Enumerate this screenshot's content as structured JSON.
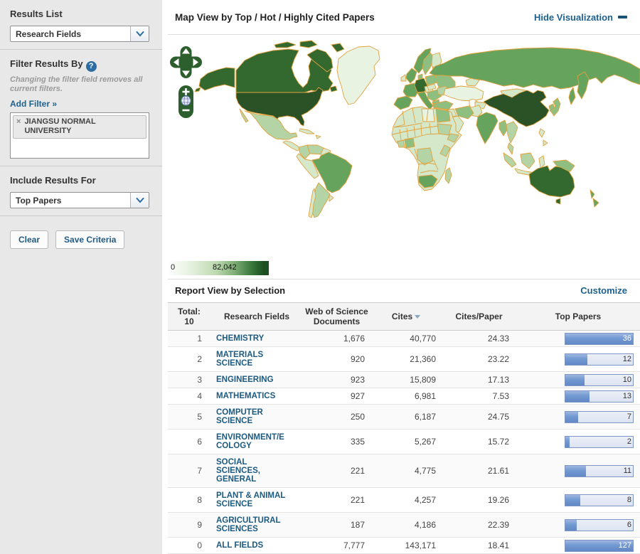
{
  "sidebar": {
    "results_list_label": "Results List",
    "results_list_value": "Research Fields",
    "filter_by_label": "Filter Results By",
    "filter_note": "Changing the filter field removes all current filters.",
    "add_filter_label": "Add Filter »",
    "filter_tag": "JIANGSU NORMAL UNIVERSITY",
    "include_label": "Include Results For",
    "include_value": "Top Papers",
    "clear_label": "Clear",
    "save_label": "Save Criteria"
  },
  "map_panel": {
    "title": "Map View by Top / Hot / Highly Cited Papers",
    "hide_label": "Hide Visualization",
    "legend_min": "0",
    "legend_max": "82,042",
    "color_low": "#e9f3e1",
    "color_high": "#1d4f21",
    "border_color": "#e0a23e"
  },
  "report": {
    "title": "Report View by Selection",
    "customize_label": "Customize"
  },
  "table": {
    "total_label": "Total:",
    "total_count": "10",
    "col_field": "Research Fields",
    "col_docs": "Web of Science Documents",
    "col_cites": "Cites",
    "col_cpp": "Cites/Paper",
    "col_top": "Top Papers",
    "rows": [
      {
        "rank": "1",
        "field": "CHEMISTRY",
        "docs": "1,676",
        "cites": "40,770",
        "cpp": "24.33",
        "top": "36",
        "bar_pct": 100
      },
      {
        "rank": "2",
        "field": "MATERIALS\nSCIENCE",
        "docs": "920",
        "cites": "21,360",
        "cpp": "23.22",
        "top": "12",
        "bar_pct": 33
      },
      {
        "rank": "3",
        "field": "ENGINEERING",
        "docs": "923",
        "cites": "15,809",
        "cpp": "17.13",
        "top": "10",
        "bar_pct": 28
      },
      {
        "rank": "4",
        "field": "MATHEMATICS",
        "docs": "927",
        "cites": "6,981",
        "cpp": "7.53",
        "top": "13",
        "bar_pct": 36
      },
      {
        "rank": "5",
        "field": "COMPUTER\nSCIENCE",
        "docs": "250",
        "cites": "6,187",
        "cpp": "24.75",
        "top": "7",
        "bar_pct": 19
      },
      {
        "rank": "6",
        "field": "ENVIRONMENT/E\nCOLOGY",
        "docs": "335",
        "cites": "5,267",
        "cpp": "15.72",
        "top": "2",
        "bar_pct": 6
      },
      {
        "rank": "7",
        "field": "SOCIAL\nSCIENCES,\nGENERAL",
        "docs": "221",
        "cites": "4,775",
        "cpp": "21.61",
        "top": "11",
        "bar_pct": 31
      },
      {
        "rank": "8",
        "field": "PLANT & ANIMAL\nSCIENCE",
        "docs": "221",
        "cites": "4,257",
        "cpp": "19.26",
        "top": "8",
        "bar_pct": 22
      },
      {
        "rank": "9",
        "field": "AGRICULTURAL\nSCIENCES",
        "docs": "187",
        "cites": "4,186",
        "cpp": "22.39",
        "top": "6",
        "bar_pct": 17
      },
      {
        "rank": "0",
        "field": "ALL FIELDS",
        "docs": "7,777",
        "cites": "143,171",
        "cpp": "18.41",
        "top": "127",
        "bar_pct": 100
      }
    ]
  }
}
